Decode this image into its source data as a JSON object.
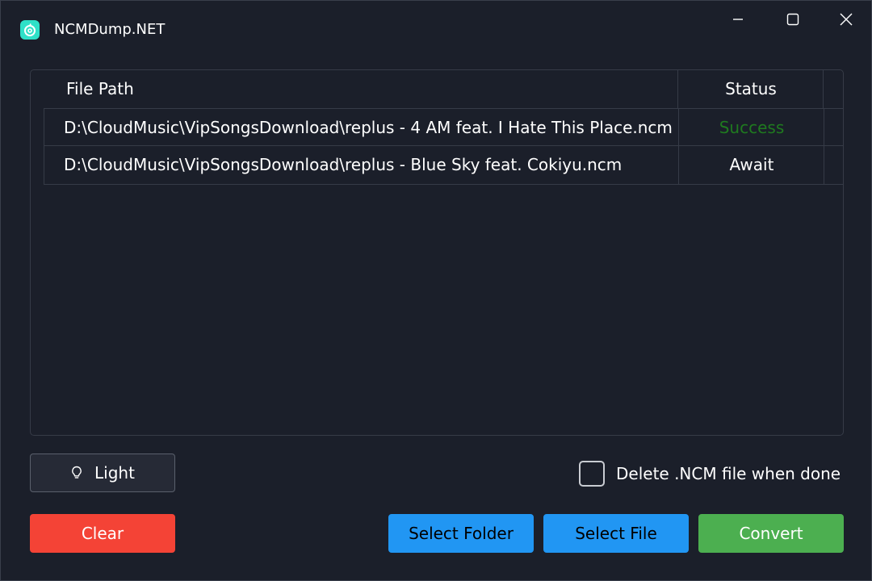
{
  "window": {
    "title": "NCMDump.NET",
    "icon": "netease-music-icon"
  },
  "table": {
    "columns": {
      "path": "File Path",
      "status": "Status"
    },
    "rows": [
      {
        "path": "D:\\CloudMusic\\VipSongsDownload\\replus - 4 AM feat. I Hate This Place.ncm",
        "status": "Success",
        "status_color": "#1f7a1f"
      },
      {
        "path": "D:\\CloudMusic\\VipSongsDownload\\replus - Blue Sky feat. Cokiyu.ncm",
        "status": "Await",
        "status_color": "#ffffff"
      }
    ]
  },
  "controls": {
    "theme_button": "Light",
    "delete_checkbox_label": "Delete .NCM file when done",
    "delete_checked": false,
    "clear_button": "Clear",
    "select_folder_button": "Select Folder",
    "select_file_button": "Select File",
    "convert_button": "Convert"
  },
  "colors": {
    "background": "#1b1f2a",
    "clear": "#f44336",
    "select": "#2196f3",
    "convert": "#4caf50",
    "accent_icon": "#2fe0c8"
  }
}
